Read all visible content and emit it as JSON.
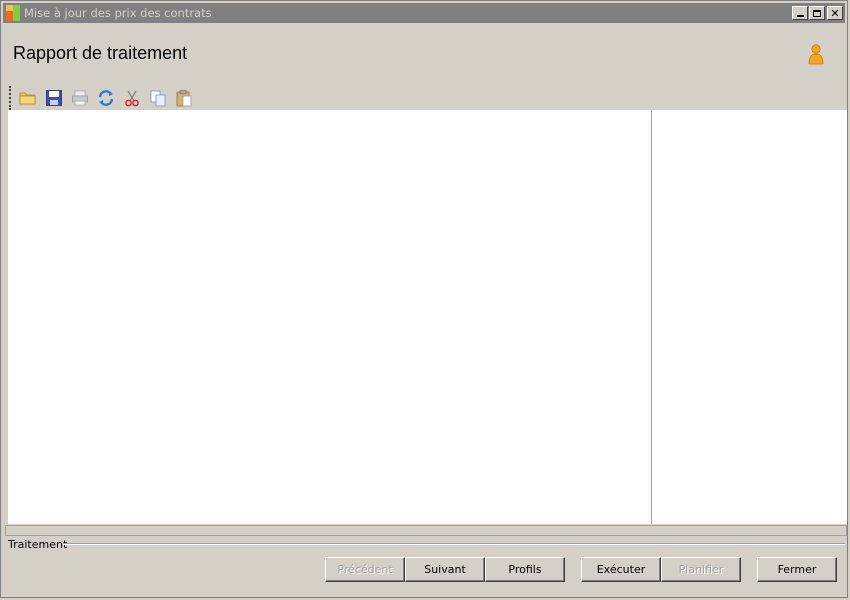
{
  "window": {
    "title": "Mise à jour des prix des contrats"
  },
  "header": {
    "title": "Rapport de traitement",
    "user_icon": "user-icon"
  },
  "toolbar": {
    "items": [
      {
        "name": "open-folder-icon",
        "enabled": true
      },
      {
        "name": "save-icon",
        "enabled": true
      },
      {
        "name": "print-icon",
        "enabled": false
      },
      {
        "name": "refresh-icon",
        "enabled": true
      },
      {
        "name": "cut-icon",
        "enabled": true
      },
      {
        "name": "copy-icon",
        "enabled": true
      },
      {
        "name": "paste-icon",
        "enabled": true
      }
    ]
  },
  "footer": {
    "group_label": "Traitement",
    "buttons": {
      "previous": "Précédent",
      "next": "Suivant",
      "profiles": "Profils",
      "execute": "Exécuter",
      "schedule": "Planifier",
      "close": "Fermer"
    }
  },
  "colors": {
    "titlebar": "#808080",
    "window_bg": "#d4d0c8",
    "panel_bg": "#ffffff"
  }
}
